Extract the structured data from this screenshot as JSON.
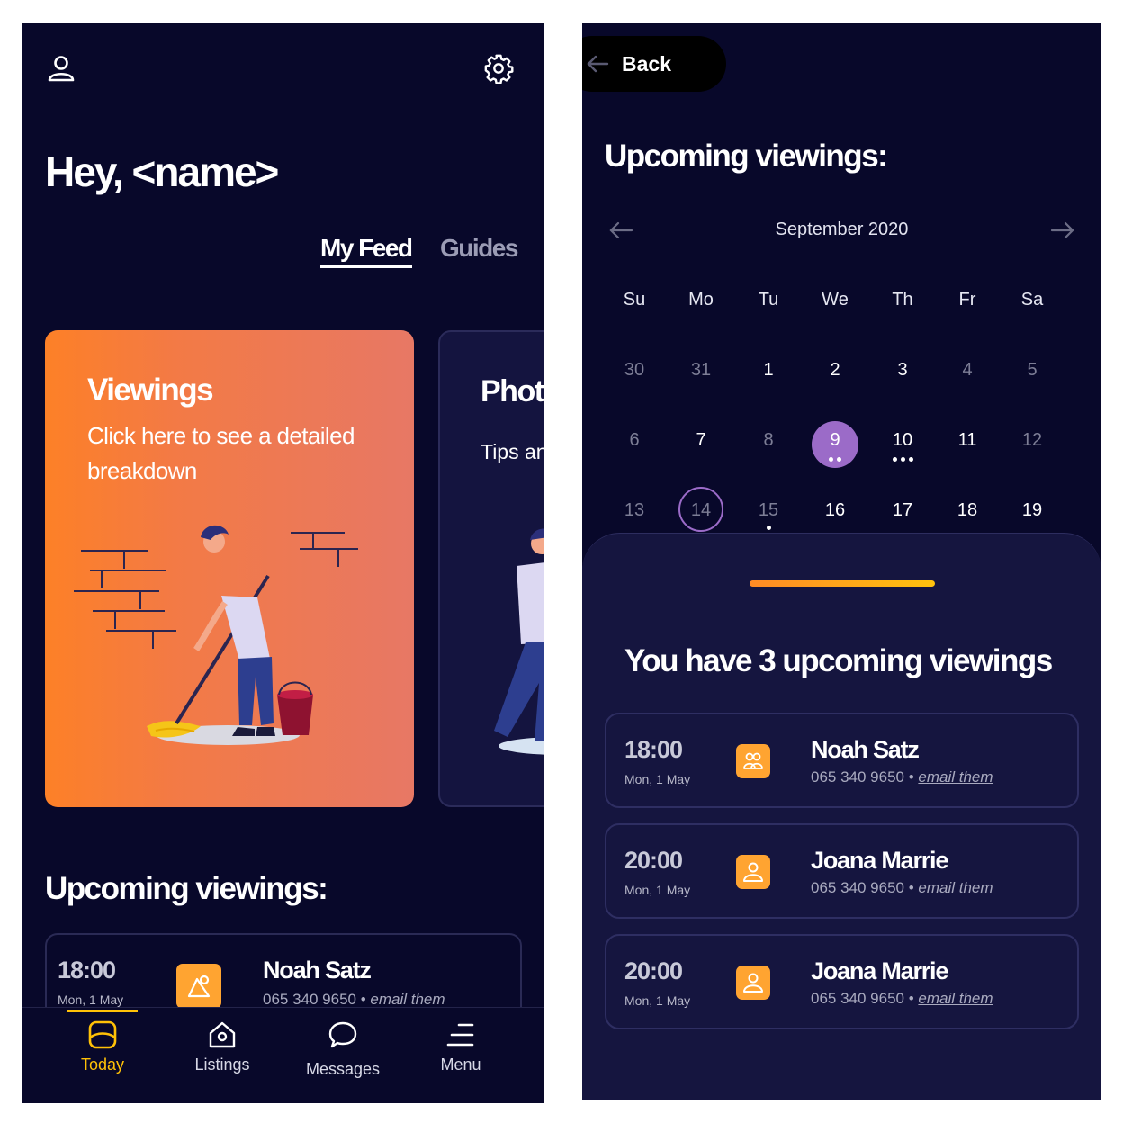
{
  "left": {
    "greeting": "Hey, <name>",
    "tabs": {
      "active": "My Feed",
      "inactive": "Guides"
    },
    "card_viewings": {
      "title": "Viewings",
      "subtitle": "Click here to see a detailed breakdown"
    },
    "card_photos": {
      "title": "Photos",
      "subtitle": "Tips and tricks for selling"
    },
    "section_title": "Upcoming viewings:",
    "viewing": {
      "time": "18:00",
      "date": "Mon, 1 May",
      "name": "Noah Satz",
      "phone": "065 340 9650",
      "email": "email them"
    },
    "nav": [
      {
        "label": "Today",
        "icon": "today-icon",
        "active": true
      },
      {
        "label": "Listings",
        "icon": "home-icon",
        "active": false
      },
      {
        "label": "Messages",
        "icon": "chat-icon",
        "active": false
      },
      {
        "label": "Menu",
        "icon": "menu-icon",
        "active": false
      }
    ],
    "colors": {
      "accent": "#ffc107",
      "card_gradient_start": "#fd8027",
      "card_gradient_end": "#e77865",
      "background": "#08082a"
    }
  },
  "right": {
    "back_label": "Back",
    "title": "Upcoming viewings:",
    "calendar": {
      "month": "September 2020",
      "weekdays": [
        "Su",
        "Mo",
        "Tu",
        "We",
        "Th",
        "Fr",
        "Sa"
      ],
      "rows": [
        [
          {
            "d": "30",
            "muted": true
          },
          {
            "d": "31",
            "muted": true
          },
          {
            "d": "1"
          },
          {
            "d": "2"
          },
          {
            "d": "3"
          },
          {
            "d": "4",
            "muted": true
          },
          {
            "d": "5",
            "muted": true
          }
        ],
        [
          {
            "d": "6",
            "muted": true
          },
          {
            "d": "7"
          },
          {
            "d": "8",
            "muted": true
          },
          {
            "d": "9",
            "selected": true,
            "dots": 2
          },
          {
            "d": "10",
            "dots": 3
          },
          {
            "d": "11"
          },
          {
            "d": "12",
            "muted": true
          }
        ],
        [
          {
            "d": "13",
            "muted": true
          },
          {
            "d": "14",
            "muted": true,
            "today": true
          },
          {
            "d": "15",
            "muted": true,
            "dots": 1
          },
          {
            "d": "16"
          },
          {
            "d": "17"
          },
          {
            "d": "18"
          },
          {
            "d": "19"
          }
        ]
      ],
      "selected_color": "#9b6bc8"
    },
    "sheet_title": "You have 3 upcoming viewings",
    "viewings": [
      {
        "time": "18:00",
        "date": "Mon, 1 May",
        "name": "Noah Satz",
        "phone": "065 340 9650",
        "email": "email them",
        "icon": "group-icon"
      },
      {
        "time": "20:00",
        "date": "Mon, 1 May",
        "name": "Joana Marrie",
        "phone": "065 340 9650",
        "email": "email them",
        "icon": "person-icon"
      },
      {
        "time": "20:00",
        "date": "Mon, 1 May",
        "name": "Joana Marrie",
        "phone": "065 340 9650",
        "email": "email them",
        "icon": "person-icon"
      }
    ]
  }
}
